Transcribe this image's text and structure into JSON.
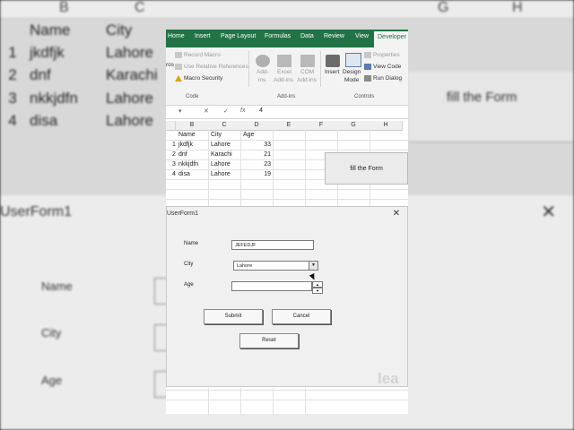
{
  "background": {
    "col_headers": [
      "B",
      "C",
      "G",
      "H"
    ],
    "headers": [
      "Name",
      "City"
    ],
    "rows": [
      {
        "num": "1",
        "name": "jkdfjk",
        "city": "Lahore"
      },
      {
        "num": "2",
        "name": "dnf",
        "city": "Karachi"
      },
      {
        "num": "3",
        "name": "nkkjdfn",
        "city": "Lahore"
      },
      {
        "num": "4",
        "name": "disa",
        "city": "Lahore"
      }
    ],
    "fill_label": "fill the Form",
    "dialog_title": "UserForm1",
    "labels": [
      "Name",
      "City",
      "Age"
    ],
    "watermark": "lea"
  },
  "ribbon": {
    "tabs": [
      "Home",
      "Insert",
      "Page Layout",
      "Formulas",
      "Data",
      "Review",
      "View",
      "Developer"
    ],
    "active_tab": "Developer",
    "code_group": {
      "label": "Code",
      "partial_label": "ros",
      "record_macro": "Record Macro",
      "use_relative": "Use Relative References",
      "macro_security": "Macro Security"
    },
    "addins_group": {
      "label": "Add-ins",
      "addins_1": "Add-",
      "addins_2": "ins",
      "excel_1": "Excel",
      "excel_2": "Add-ins",
      "com_1": "COM",
      "com_2": "Add-ins"
    },
    "controls_group": {
      "label": "Controls",
      "insert": "Insert",
      "design_1": "Design",
      "design_2": "Mode",
      "properties": "Properties",
      "view_code": "View Code",
      "run_dialog": "Run Dialog"
    }
  },
  "formula_bar": {
    "cell_ref_sep": "▾",
    "cancel": "✕",
    "enter": "✓",
    "fx": "fx",
    "value": "4"
  },
  "sheet": {
    "columns": [
      "B",
      "C",
      "D",
      "E",
      "F",
      "G",
      "H"
    ],
    "header_row": {
      "name": "Name",
      "city": "City",
      "age": "Age"
    },
    "rows": [
      {
        "num": "1",
        "name": "jkdfjk",
        "city": "Lahore",
        "age": "33"
      },
      {
        "num": "2",
        "name": "dnf",
        "city": "Karachi",
        "age": "21"
      },
      {
        "num": "3",
        "name": "nkkjdfn",
        "city": "Lahore",
        "age": "23"
      },
      {
        "num": "4",
        "name": "disa",
        "city": "Lahore",
        "age": "19"
      }
    ],
    "fill_button": "fill the Form"
  },
  "userform": {
    "title": "UserForm1",
    "close": "✕",
    "name_label": "Name",
    "name_value": "JEFEDJF",
    "city_label": "City",
    "city_value": "Lahore",
    "age_label": "Age",
    "age_value": "",
    "submit": "Submit",
    "cancel": "Cancel",
    "reset": "Reset"
  },
  "watermark": "lea",
  "colors": {
    "ribbon_green": "#217346",
    "ribbon_bg": "#f3f3f3",
    "form_bg": "#f0f0f0"
  }
}
